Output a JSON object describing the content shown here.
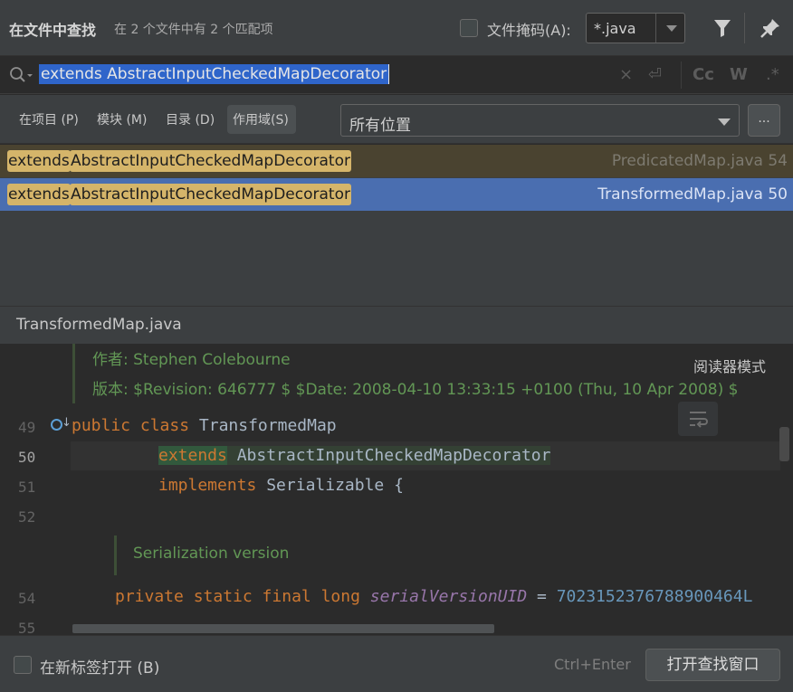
{
  "header": {
    "title": "在文件中查找",
    "subtitle": "在 2 个文件中有 2 个匹配项",
    "file_mask_label": "文件掩码(A):",
    "file_mask_value": "*.java",
    "file_mask_checked": false
  },
  "search": {
    "query": "extends AbstractInputCheckedMapDecorator",
    "tools": [
      "×",
      "⏎",
      "Cc",
      "W",
      ".*"
    ]
  },
  "scope": {
    "tabs": [
      "在项目 (P)",
      "模块 (M)",
      "目录 (D)",
      "作用域(S)"
    ],
    "active_tab": "作用域(S)",
    "location_value": "所有位置",
    "more_label": "..."
  },
  "results": [
    {
      "keyword": "extends",
      "match": "AbstractInputCheckedMapDecorator",
      "file": "PredicatedMap.java 54",
      "selected": false
    },
    {
      "keyword": "extends",
      "match": "AbstractInputCheckedMapDecorator",
      "file": "TransformedMap.java 50",
      "selected": true
    }
  ],
  "preview": {
    "file_name": "TransformedMap.java",
    "reader_mode": "阅读器模式",
    "doc_author": "作者: Stephen Colebourne",
    "doc_version": "版本: $Revision: 646777 $ $Date: 2008-04-10 13:33:15 +0100 (Thu, 10 Apr 2008) $",
    "doc_serialization": "Serialization version",
    "line_numbers": [
      "49",
      "50",
      "51",
      "52",
      "54",
      "55"
    ],
    "code": {
      "l49_kw1": "public",
      "l49_kw2": "class",
      "l49_name": "TransformedMap",
      "l50_kw": "extends",
      "l50_name": "AbstractInputCheckedMapDecorator",
      "l51_kw": "implements",
      "l51_name": "Serializable {",
      "l54_kw": "private static final long",
      "l54_field": "serialVersionUID",
      "l54_eq": " = ",
      "l54_val": "7023152376788900464L"
    }
  },
  "footer": {
    "new_tab_label": "在新标签打开 (B)",
    "shortcut": "Ctrl+Enter",
    "open_window_label": "打开查找窗口"
  },
  "colors": {
    "background": "#2b2b2b",
    "panel": "#3c3f41",
    "selection": "#4a6eb0",
    "match_highlight": "#d5b56a",
    "keyword": "#cc7832",
    "doc_comment": "#629755"
  }
}
